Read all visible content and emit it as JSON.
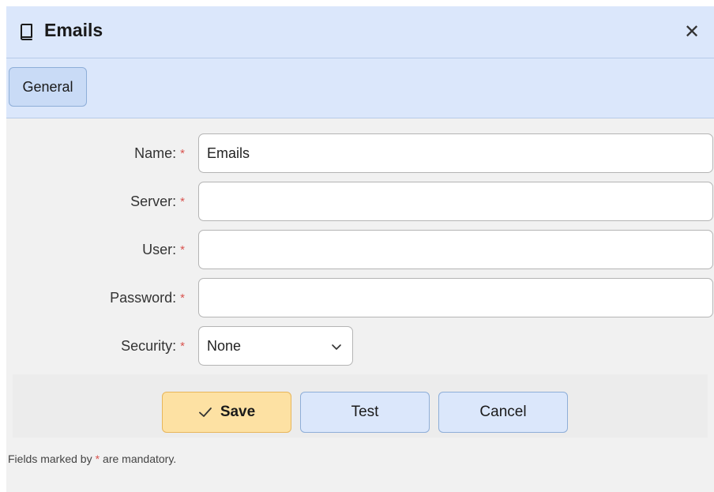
{
  "dialog": {
    "title": "Emails",
    "title_icon": "book-icon",
    "close_icon": "close-icon",
    "close_glyph": "✕"
  },
  "tabs": [
    {
      "label": "General",
      "active": true
    }
  ],
  "form": {
    "required_marker": "*",
    "fields": [
      {
        "label": "Name:",
        "value": "Emails",
        "placeholder": ""
      },
      {
        "label": "Server:",
        "value": "",
        "placeholder": ""
      },
      {
        "label": "User:",
        "value": "",
        "placeholder": ""
      },
      {
        "label": "Password:",
        "value": "",
        "placeholder": ""
      }
    ],
    "security": {
      "label": "Security:",
      "selected": "None"
    }
  },
  "buttons": {
    "save": "Save",
    "test": "Test",
    "cancel": "Cancel"
  },
  "footnote": {
    "before": "Fields marked by",
    "marker": "*",
    "after": "are mandatory."
  },
  "colors": {
    "header_bg": "#dbe7fb",
    "primary_button": "#fde1a3",
    "required": "#d9534f"
  }
}
